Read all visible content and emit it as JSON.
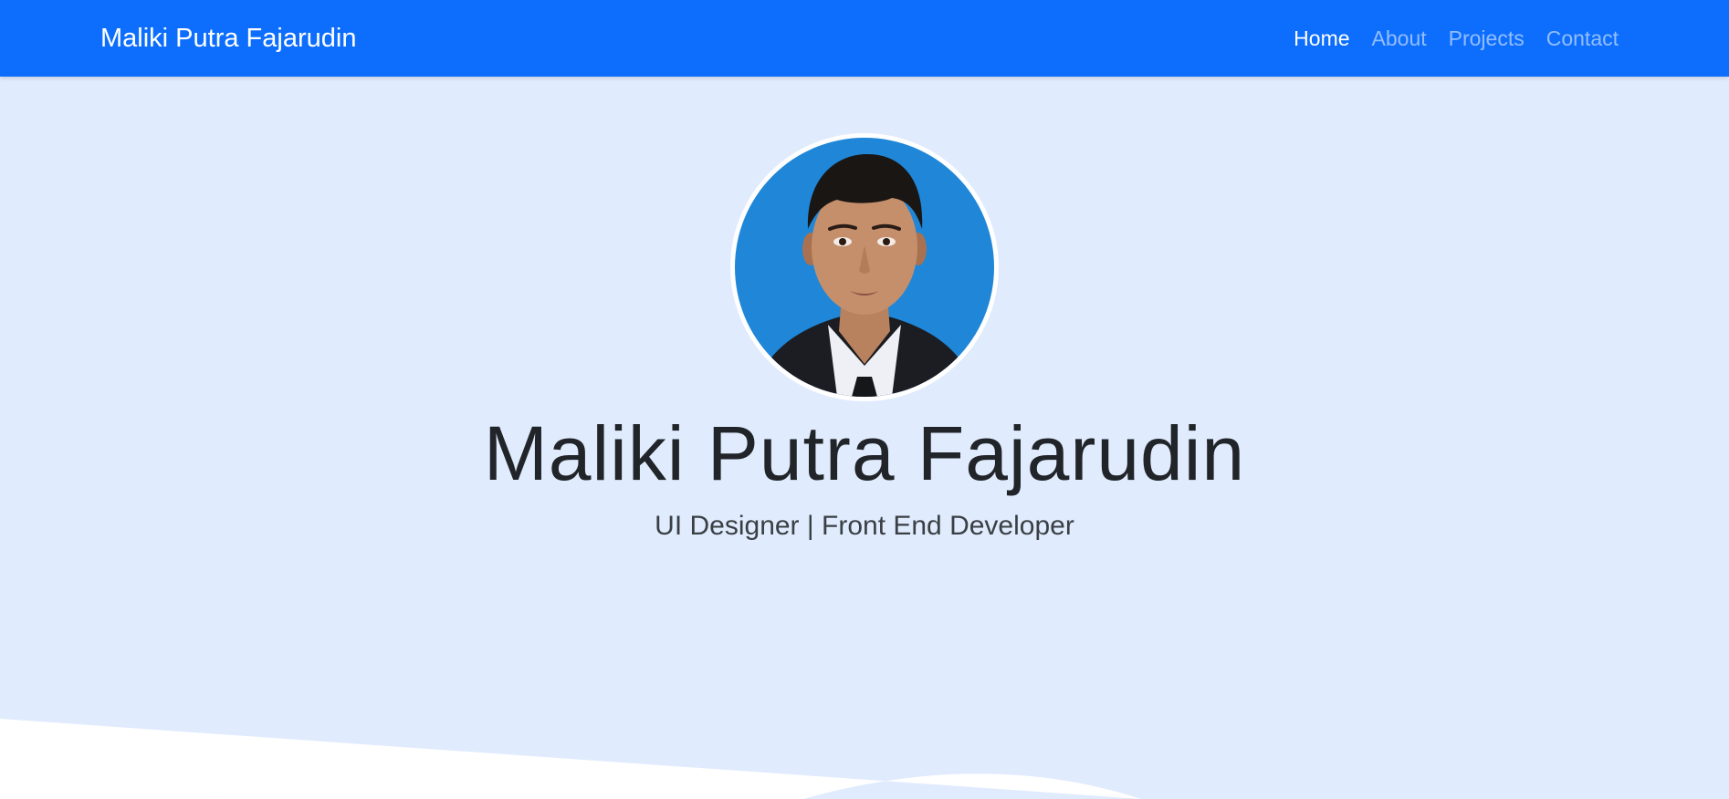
{
  "navbar": {
    "brand": "Maliki Putra Fajarudin",
    "links": [
      {
        "label": "Home",
        "active": true
      },
      {
        "label": "About",
        "active": false
      },
      {
        "label": "Projects",
        "active": false
      },
      {
        "label": "Contact",
        "active": false
      }
    ]
  },
  "hero": {
    "avatar_alt": "profile-photo",
    "title": "Maliki Putra Fajarudin",
    "subtitle": "UI Designer | Front End Developer"
  },
  "colors": {
    "primary": "#0d6efd",
    "hero_background": "#e0ebfd",
    "wave": "#ffffff"
  }
}
